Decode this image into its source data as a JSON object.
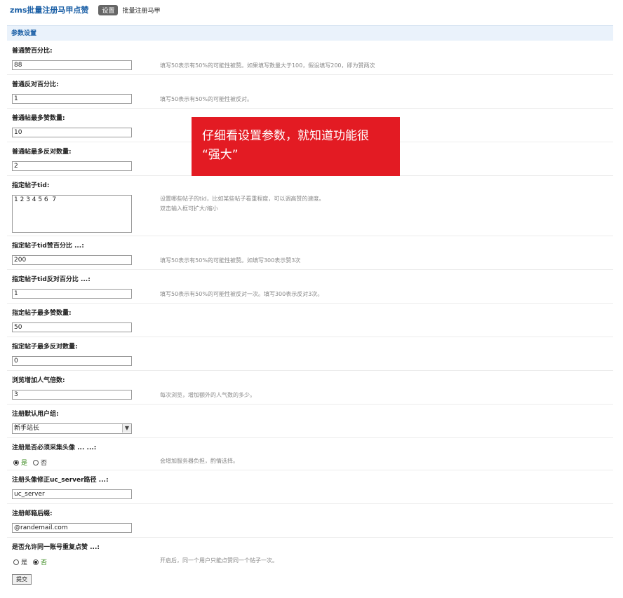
{
  "header": {
    "app_title": "zms批量注册马甲点赞",
    "tabs": [
      {
        "label": "设置",
        "active": true
      },
      {
        "label": "批量注册马甲",
        "active": false
      }
    ]
  },
  "section_title": "参数设置",
  "settings": [
    {
      "label": "普通赞百分比:",
      "value": "88",
      "hint": "填写50表示有50%的可能性被赞。如果填写数量大于100，假设填写200，即为赞两次"
    },
    {
      "label": "普通反对百分比:",
      "value": "1",
      "hint": "填写50表示有50%的可能性被反对。"
    },
    {
      "label": "普通帖最多赞数量:",
      "value": "10",
      "hint": ""
    },
    {
      "label": "普通帖最多反对数量:",
      "value": "2",
      "hint": ""
    },
    {
      "label": "指定帖子tid:",
      "value": "1 2 3 4 5 6  7",
      "hint": "设置哪些帖子的tid，比如某些帖子看重程度，可以调高赞的速度。",
      "hint2": "双击输入框可扩大/缩小"
    },
    {
      "label": "指定帖子tid赞百分比 ...:",
      "value": "200",
      "hint": "填写50表示有50%的可能性被赞。如填写300表示赞3次"
    },
    {
      "label": "指定帖子tid反对百分比 ...:",
      "value": "1",
      "hint": "填写50表示有50%的可能性被反对一次。填写300表示反对3次。"
    },
    {
      "label": "指定帖子最多赞数量:",
      "value": "50",
      "hint": ""
    },
    {
      "label": "指定帖子最多反对数量:",
      "value": "0",
      "hint": ""
    },
    {
      "label": "浏览增加人气倍数:",
      "value": "3",
      "hint": "每次浏览，增加额外的人气数的多少。"
    },
    {
      "label": "注册默认用户组:",
      "value": "新手站长",
      "hint": ""
    },
    {
      "label": "注册是否必须采集头像 ... ...:",
      "options": [
        "是",
        "否"
      ],
      "selected": "是",
      "hint": "会增加服务器负担，酌情选择。"
    },
    {
      "label": "注册头像修正uc_server路径 ...:",
      "value": "uc_server",
      "hint": ""
    },
    {
      "label": "注册邮箱后缀:",
      "value": "@randemail.com",
      "hint": ""
    },
    {
      "label": "是否允许同一账号重复点赞 ...:",
      "options": [
        "是",
        "否"
      ],
      "selected": "否",
      "hint": "开启后，同一个用户只能点赞同一个帖子一次。"
    }
  ],
  "submit_label": "提交",
  "callout": {
    "line1": "仔细看设置参数，就知道功能很",
    "line2": "“强大”"
  },
  "colors": {
    "title_blue": "#1a5fa6",
    "section_bg": "#eaf2fb",
    "callout_red": "#e31b23",
    "radio_selected_green": "#3a8a1e"
  }
}
